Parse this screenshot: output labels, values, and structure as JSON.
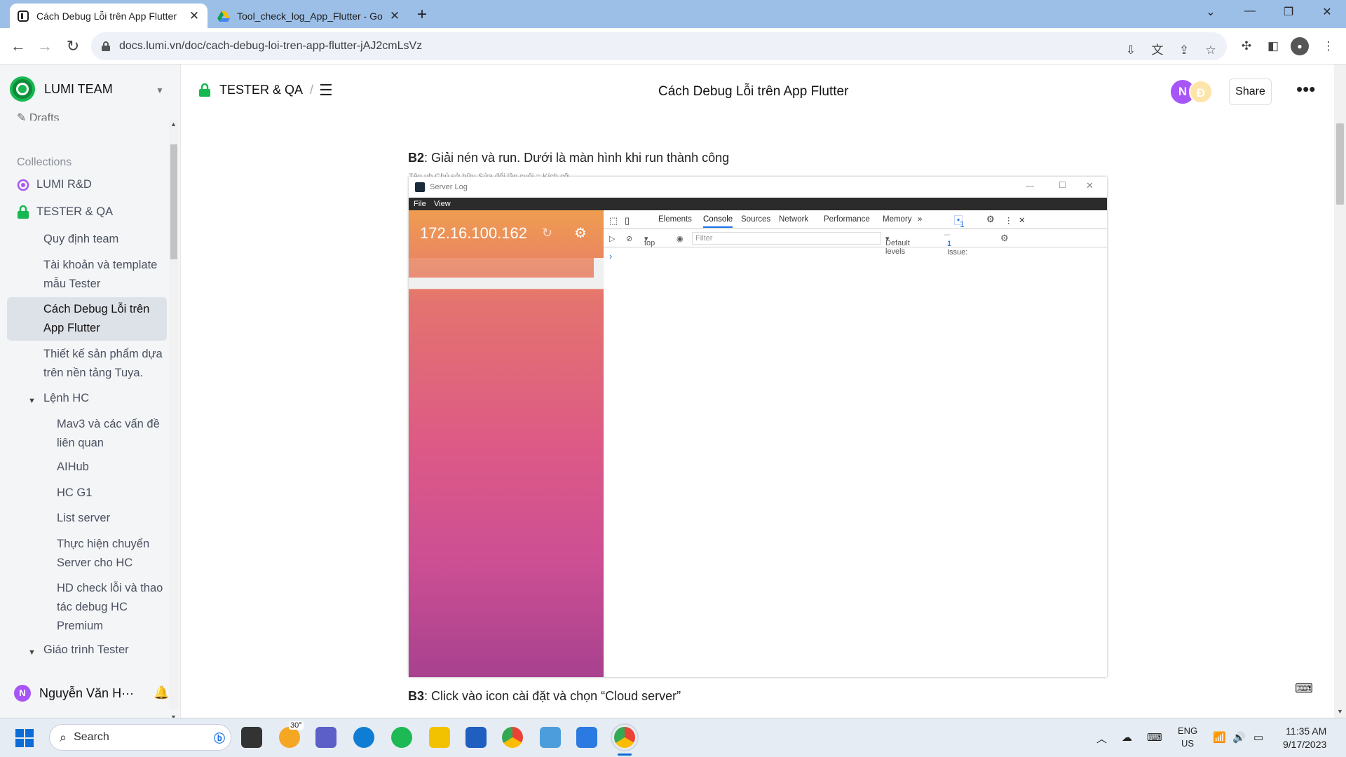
{
  "browser": {
    "tabs": [
      {
        "title": "Cách Debug Lỗi trên App Flutter",
        "active": true
      },
      {
        "title": "Tool_check_log_App_Flutter - Go",
        "active": false
      }
    ],
    "url": "docs.lumi.vn/doc/cach-debug-loi-tren-app-flutter-jAJ2cmLsVz"
  },
  "sidebar": {
    "team_name": "LUMI TEAM",
    "drafts_label": "Drafts",
    "collections_label": "Collections",
    "collections": [
      "LUMI R&D",
      "TESTER & QA"
    ],
    "docs": [
      "Quy định team",
      "Tài khoản và template mẫu Tester",
      "Cách Debug Lỗi trên App Flutter",
      "Thiết kế sản phẩm dựa trên nền tảng Tuya.",
      "Lệnh HC",
      "Mav3 và các vấn đề liên quan",
      "AIHub",
      "HC G1",
      "List server",
      "Thực hiện chuyển Server cho HC",
      "HD check lỗi và thao tác debug HC Premium",
      "Giáo trình Tester"
    ],
    "user_name": "Nguyễn Văn H···",
    "user_initial": "N"
  },
  "header": {
    "breadcrumb": "TESTER & QA",
    "breadcrumb_sep": "/",
    "title": "Cách Debug Lỗi trên App Flutter",
    "avatars": [
      "N",
      "Đ"
    ],
    "share_label": "Share"
  },
  "document": {
    "step2_label": "B2",
    "step2_text": ": Giải nén và run. Dưới là màn hình khi run thành công",
    "step3_label": "B3",
    "step3_text": ": Click vào icon cài đặt và chọn “Cloud server”",
    "cutoff_text": "Tên        ub                                                          Chủ sở hữu                        Sửa đổi lần cuối =                        Kích cỡ"
  },
  "server_log": {
    "window_title": "Server Log",
    "menu": [
      "File",
      "View"
    ],
    "ip": "172.16.100.162",
    "devtools_tabs": [
      "Elements",
      "Console",
      "Sources",
      "Network",
      "Performance",
      "Memory"
    ],
    "active_tab": "Console",
    "issues_badge": "1",
    "context": "top",
    "filter_placeholder": "Filter",
    "levels": "Default levels",
    "issues_label": "1 Issue:",
    "issues_count": "1",
    "prompt": "›"
  },
  "taskbar": {
    "search_label": "Search",
    "weather": "30°",
    "lang_top": "ENG",
    "lang_bottom": "US",
    "time": "11:35 AM",
    "date": "9/17/2023"
  },
  "colors": {
    "tab_strip": "#9cbfe8",
    "sidebar_bg": "#f4f5f7",
    "accent_green": "#17b851",
    "avatar_purple": "#a855f7"
  }
}
